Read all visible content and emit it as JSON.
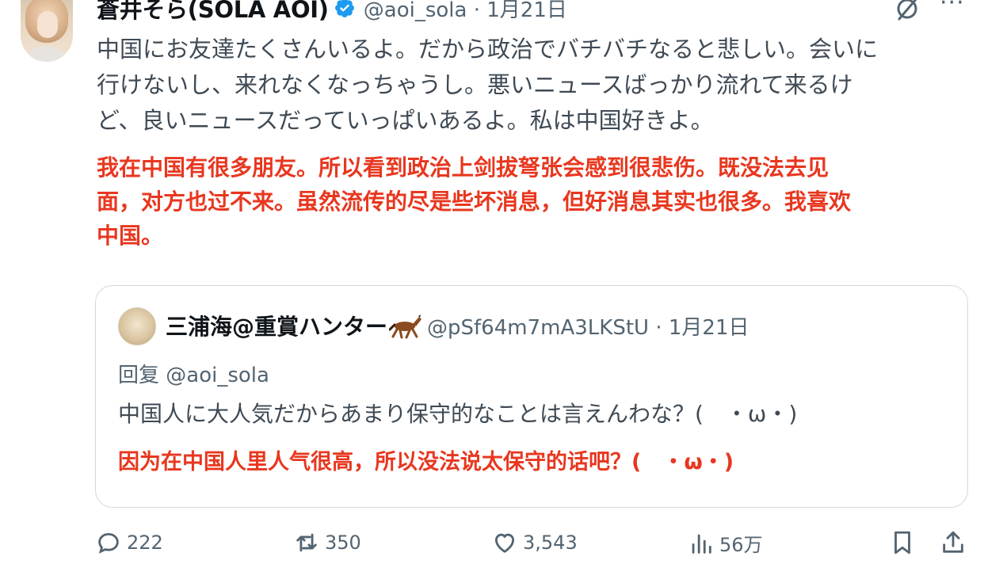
{
  "author": {
    "display_name": "蒼井そら(SOLA AOI)",
    "handle": "@aoi_sola",
    "date": "1月21日",
    "avatar_icon": "avatar-photo",
    "verified_icon": "verified-badge-icon"
  },
  "tweet": {
    "text_jp_lines": [
      "中国にお友達たくさんいるよ。だから政治でバチバチなると悲しい。会いに",
      "行けないし、来れなくなっちゃうし。悪いニュースばっかり流れて来るけ",
      "ど、良いニュースだっていっぱいあるよ。私は中国好きよ。"
    ],
    "translation_cn_lines": [
      "我在中国有很多朋友。所以看到政治上剑拔弩张会感到很悲伤。既没法去见",
      "面，对方也过不来。虽然流传的尽是些坏消息，但好消息其实也很多。我喜欢",
      "中国。"
    ]
  },
  "quote": {
    "display_name": "三浦海@重賞ハンター",
    "handle": "@pSf64m7mA3LKStU",
    "date": "1月21日",
    "reply_to": "回复 @aoi_sola",
    "text_jp": "中国人に大人気だからあまり保守的なことは言えんわな？(　・ω・)",
    "translation_cn": "因为在中国人里人气很高，所以没法说太保守的话吧？(　・ω・)"
  },
  "actions": {
    "replies": "222",
    "retweets": "350",
    "likes": "3,543",
    "views": "56万"
  },
  "colors": {
    "accent": "#1d9bf0",
    "secondary_text": "#536471",
    "translation_red": "#e8371f"
  }
}
